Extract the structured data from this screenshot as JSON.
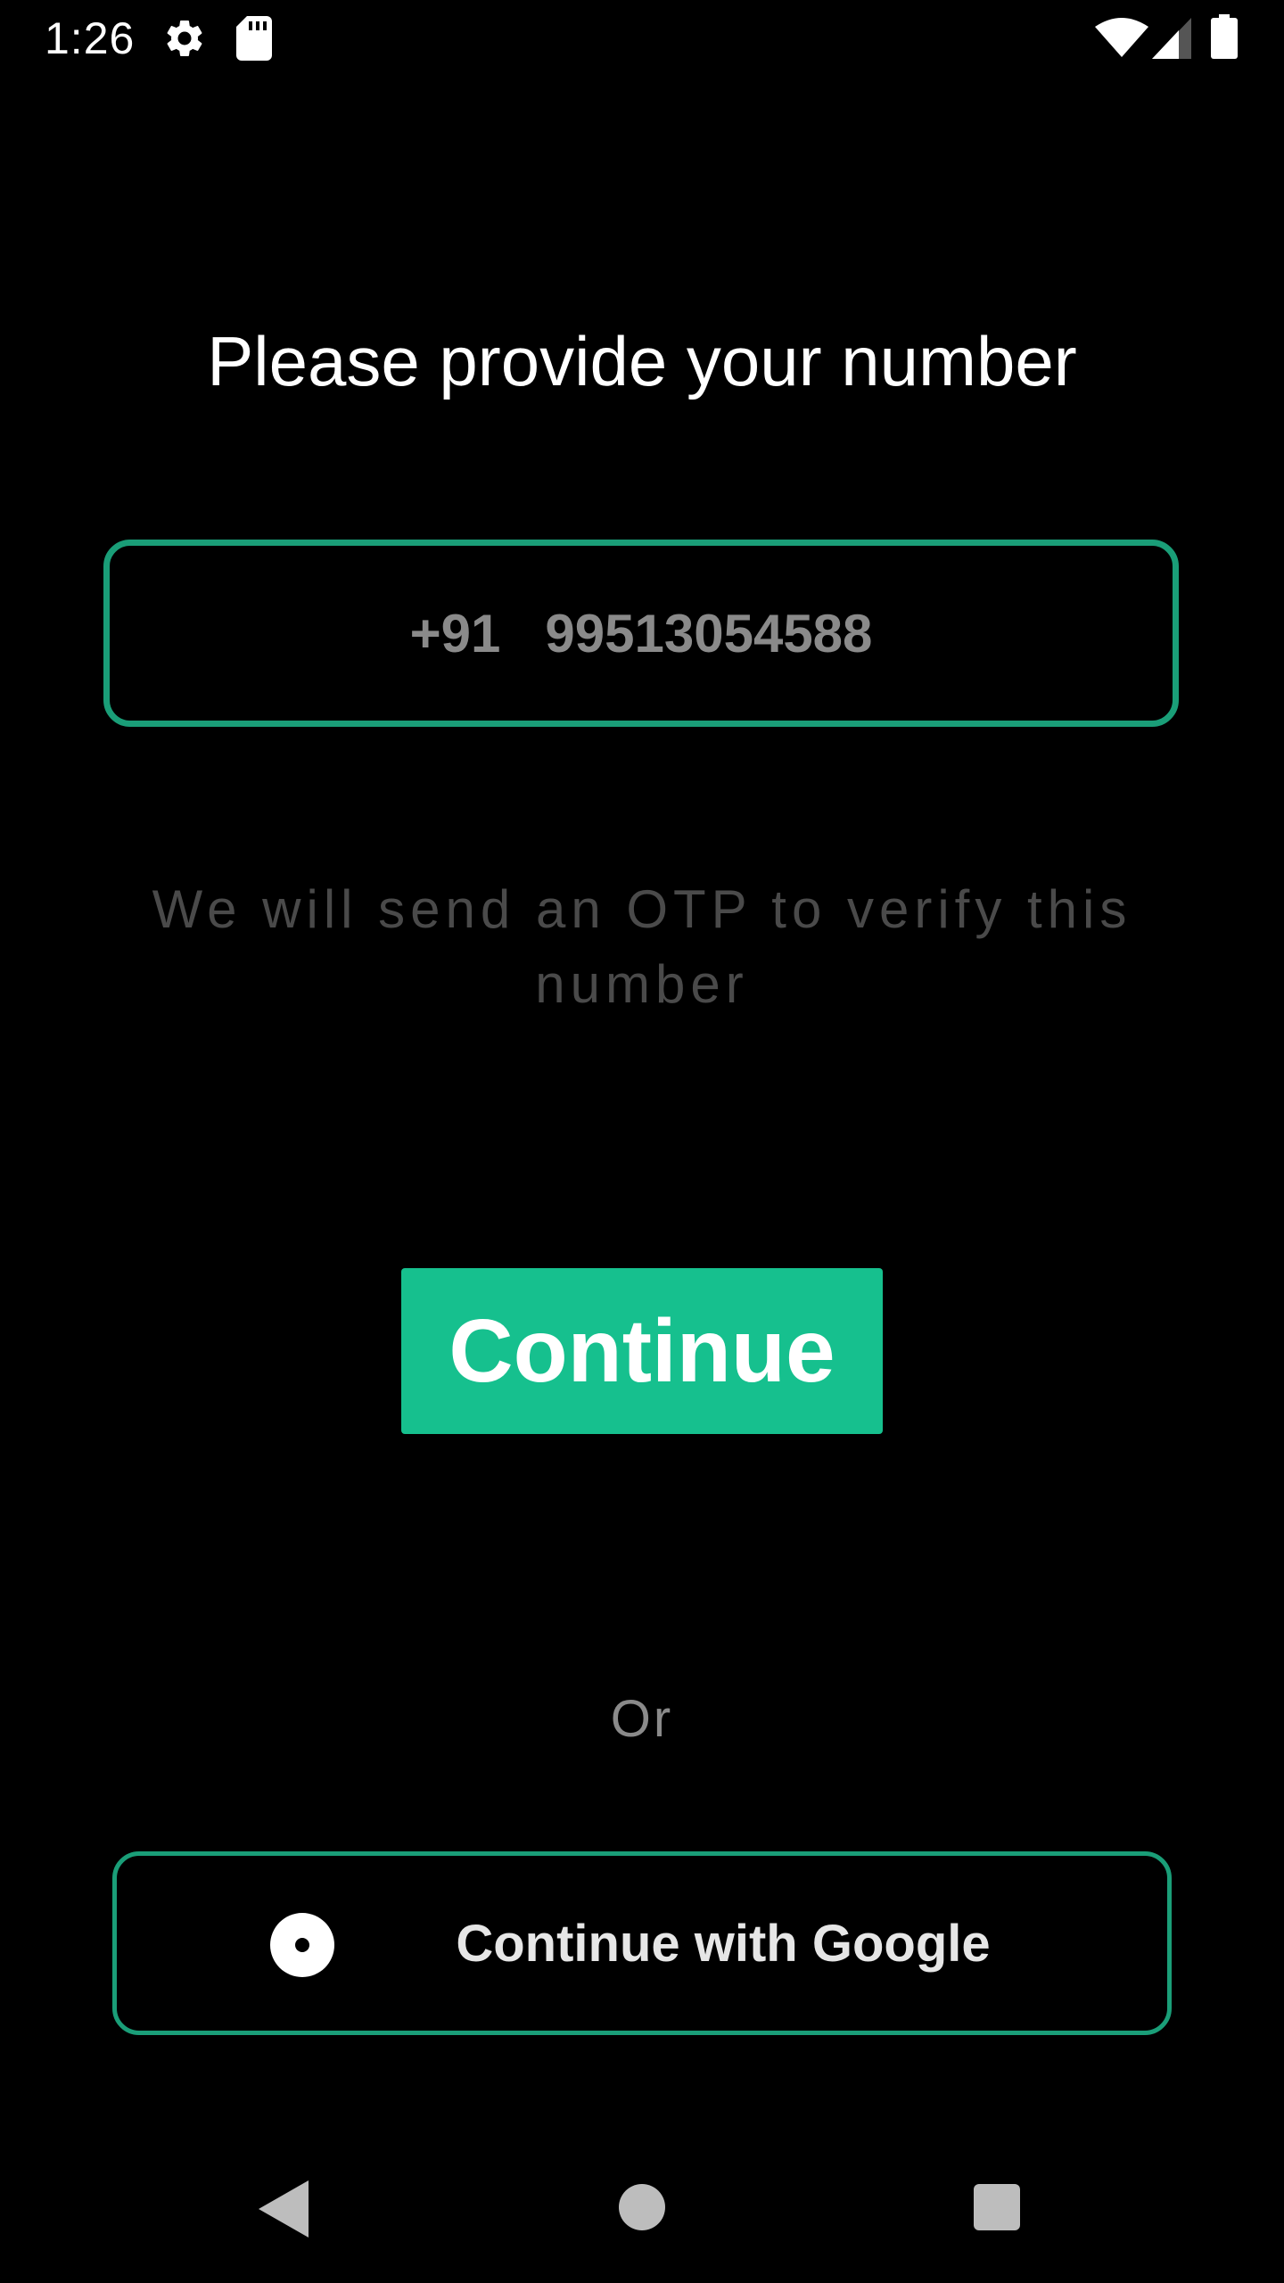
{
  "status_bar": {
    "time": "1:26",
    "icons": [
      "gear-icon",
      "sd-card-icon",
      "wifi-icon",
      "signal-icon",
      "battery-icon"
    ]
  },
  "screen": {
    "title": "Please provide your number",
    "phone": {
      "country_code": "+91",
      "number": "99513054588"
    },
    "hint": "We will send an OTP to verify this number",
    "continue_label": "Continue",
    "or_label": "Or",
    "google_label": "Continue with Google"
  },
  "nav_bar": {
    "buttons": [
      "back",
      "home",
      "recents"
    ]
  },
  "colors": {
    "background": "#000000",
    "accent": "#16c08e",
    "border_accent": "#1a9e78",
    "muted_text": "#8a8a8a",
    "hint_text": "#4a4a4a"
  }
}
